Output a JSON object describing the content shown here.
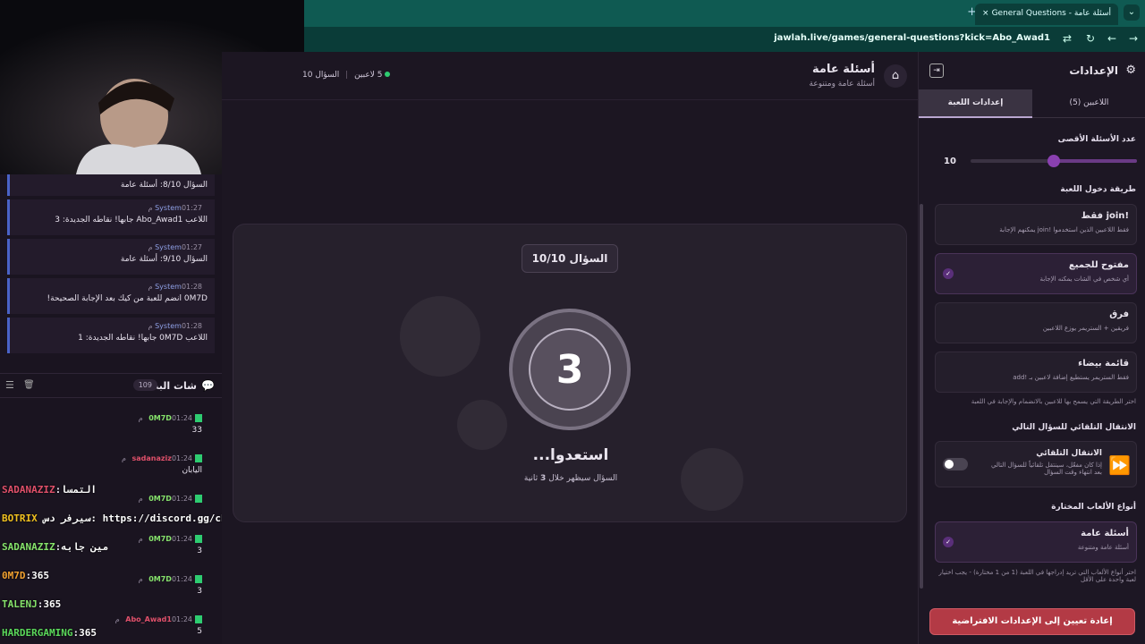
{
  "browser": {
    "tab_title": "General Questions - أسئلة عامة",
    "tab_close": "×",
    "new_tab": "+",
    "url": "jawlah.live/games/general-questions?kick=Abo_Awad1"
  },
  "header": {
    "title": "أسئلة عامة",
    "subtitle": "أسئلة عامة ومتنوعة",
    "players": "5 لاعبين",
    "question_progress": "السؤال 10"
  },
  "game": {
    "question_badge": "السؤال 10/10",
    "countdown": "3",
    "ready_text": "استعدوا...",
    "ready_sub_before": "السؤال سيظهر خلال",
    "ready_sub_num": "3",
    "ready_sub_after": "ثانية"
  },
  "system_messages": [
    {
      "sender": "",
      "time": "",
      "text": "السؤال 8/10: أسئلة عامة"
    },
    {
      "sender": "System",
      "time": "01:27 م",
      "text": "اللاعب Abo_Awad1 جابها! نقاطه الجديدة: 3"
    },
    {
      "sender": "System",
      "time": "01:27 م",
      "text": "السؤال 9/10: أسئلة عامة"
    },
    {
      "sender": "System",
      "time": "01:28 م",
      "text": "0M7D انضم للعبة من كيك بعد الإجابة الصحيحة!"
    },
    {
      "sender": "System",
      "time": "01:28 م",
      "text": "اللاعب 0M7D جابها! نقاطه الجديدة: 1"
    }
  ],
  "chat": {
    "title": "شات البث",
    "count": "109",
    "messages": [
      {
        "user": "0M7D",
        "time": "01:24 م",
        "text": "33",
        "color": "#86e36b"
      },
      {
        "user": "sadanaziz",
        "time": "01:24 م",
        "text": "اليابان",
        "color": "#e0506a"
      },
      {
        "user": "0M7D",
        "time": "01:24 م",
        "text": "",
        "color": "#86e36b"
      },
      {
        "user": "0M7D",
        "time": "01:24 م",
        "text": "3",
        "color": "#86e36b"
      },
      {
        "user": "0M7D",
        "time": "01:24 م",
        "text": "3",
        "color": "#86e36b"
      },
      {
        "user": "Abo_Awad1",
        "time": "01:24 م",
        "text": "5",
        "color": "#e0506a"
      }
    ]
  },
  "overlay_chat": [
    {
      "user": "SADANAZIZ",
      "text": "التمسا",
      "color": "#e0506a"
    },
    {
      "user": "BOTRIX",
      "text": "سيرفر دس: https://discord.gg/cETcBggJM",
      "color": "#f0c020"
    },
    {
      "user": "SADANAZIZ",
      "text": "مين جابه",
      "color": "#86e36b"
    },
    {
      "user": "0M7D",
      "text": "365",
      "color": "#f0a030"
    },
    {
      "user": "TALENJ",
      "text": "365",
      "color": "#86e36b"
    },
    {
      "user": "HARDERGAMING",
      "text": "365",
      "color": "#5bd85b"
    }
  ],
  "settings": {
    "title": "الإعدادات",
    "tab_game": "إعدادات اللعبة",
    "tab_players": "اللاعبين (5)",
    "max_questions_label": "عدد الأسئلة الأقصى",
    "max_questions_value": "10",
    "max_questions_fraction": 0.5,
    "entry_label": "طريقة دخول اللعبة",
    "options": [
      {
        "title": "!join فقط",
        "desc": "فقط اللاعبين الذين استخدموا !join يمكنهم الإجابة",
        "selected": false
      },
      {
        "title": "مفتوح للجميع",
        "desc": "أي شخص في الشات يمكنه الإجابة",
        "selected": true
      },
      {
        "title": "فرق",
        "desc": "فريقين + الستريمر يوزع اللاعبين",
        "selected": false
      },
      {
        "title": "قائمة بيضاء",
        "desc": "فقط الستريمر يستطيع إضافة لاعبين بـ !add",
        "selected": false
      }
    ],
    "entry_note": "اختر الطريقة التي يسمح بها للاعبين بالانضمام والإجابة في اللعبة",
    "auto_label": "الانتقال التلقائي للسؤال التالي",
    "auto_title": "الانتقال التلقائي",
    "auto_desc": "إذا كان مفعّل، سينتقل تلقائياً للسؤال التالي بعد انتهاء وقت السؤال",
    "auto_enabled": false,
    "types_label": "أنواع الألعاب المختارة",
    "type_title": "أسئلة عامة",
    "type_desc": "أسئلة عامة ومتنوعة",
    "types_note": "اختر أنواع الألعاب التي تريد إدراجها في اللعبة (1 من 1 مختارة) - يجب اختيار لعبة واحدة على الأقل",
    "reset": "إعادة تعيين إلى الإعدادات الافتراضية"
  },
  "colors": {
    "accent": "#7a3aa0",
    "danger": "#b33a45",
    "online": "#2ecc71",
    "system": "#4a63c8"
  }
}
